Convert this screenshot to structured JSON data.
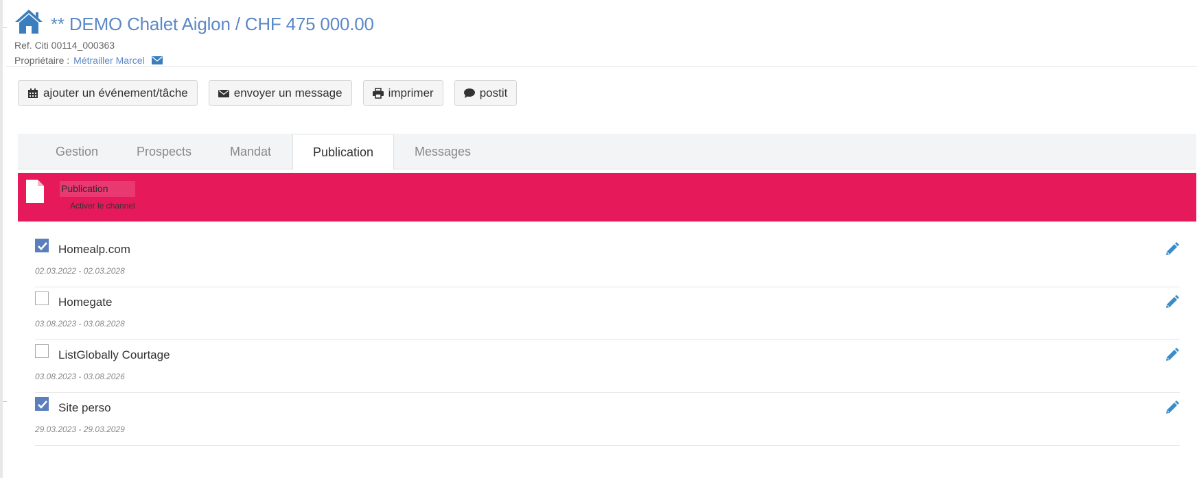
{
  "header": {
    "title": "** DEMO Chalet Aiglon / CHF 475 000.00",
    "ref": "Ref. Citi 00114_000363",
    "owner_label": "Propriétaire :",
    "owner_name": "Métrailler Marcel"
  },
  "toolbar": {
    "add_event_label": "ajouter un événement/tâche",
    "send_message_label": "envoyer un message",
    "print_label": "imprimer",
    "postit_label": "postit"
  },
  "tabs": [
    {
      "label": "Gestion",
      "active": false
    },
    {
      "label": "Prospects",
      "active": false
    },
    {
      "label": "Mandat",
      "active": false
    },
    {
      "label": "Publication",
      "active": true
    },
    {
      "label": "Messages",
      "active": false
    }
  ],
  "banner": {
    "input_value": "Publication",
    "subtitle": "Activer le channel",
    "color": "#e6195a"
  },
  "channels": [
    {
      "name": "Homealp.com",
      "dates": "02.03.2022 - 02.03.2028",
      "checked": true
    },
    {
      "name": "Homegate",
      "dates": "03.08.2023 - 03.08.2028",
      "checked": false
    },
    {
      "name": "ListGlobally Courtage",
      "dates": "03.08.2023 - 03.08.2026",
      "checked": false
    },
    {
      "name": "Site perso",
      "dates": "29.03.2023 - 29.03.2029",
      "checked": true
    }
  ],
  "colors": {
    "accent": "#5b88c6",
    "checkbox": "#5b7fbd",
    "edit_icon": "#3a8cc8"
  },
  "icons": {
    "home": "home-icon",
    "mail": "envelope-icon",
    "calendar": "calendar-icon",
    "envelope": "envelope-icon",
    "print": "printer-icon",
    "comment": "comment-icon",
    "document": "document-icon",
    "edit": "pencil-icon"
  }
}
